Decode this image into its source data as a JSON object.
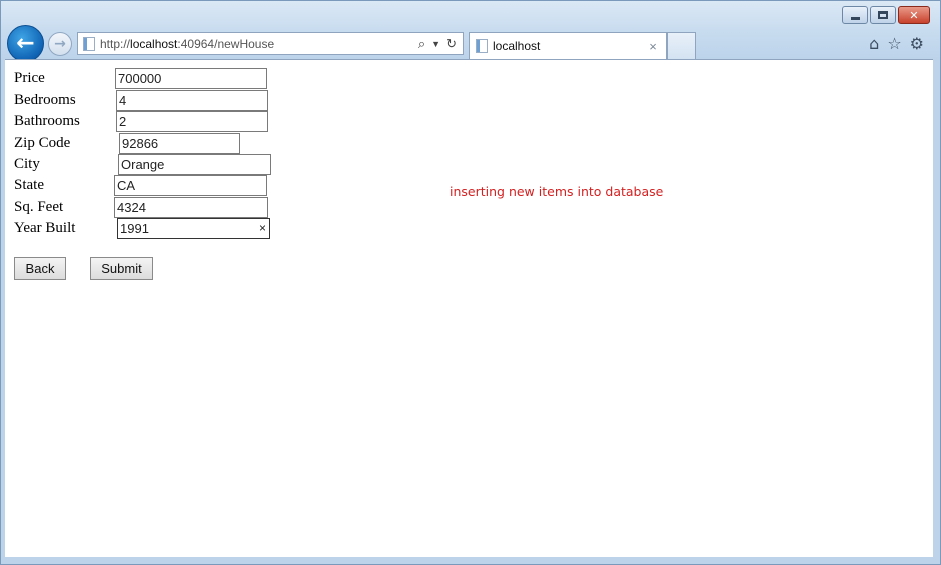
{
  "browser": {
    "url_prefix": "http://",
    "url_host": "localhost",
    "url_rest": ":40964/newHouse",
    "tab_title": "localhost",
    "tab_close": "×"
  },
  "form": {
    "fields": [
      {
        "label": "Price",
        "value": "700000"
      },
      {
        "label": "Bedrooms",
        "value": "4"
      },
      {
        "label": "Bathrooms",
        "value": "2"
      },
      {
        "label": "Zip Code",
        "value": "92866"
      },
      {
        "label": "City",
        "value": "Orange"
      },
      {
        "label": "State",
        "value": "CA"
      },
      {
        "label": "Sq. Feet",
        "value": "4324"
      },
      {
        "label": "Year Built",
        "value": "1991"
      }
    ],
    "clear_glyph": "×",
    "back_label": "Back",
    "submit_label": "Submit"
  },
  "status": {
    "message": "inserting new items into database",
    "color": "#d42020"
  },
  "icons": [
    "back-arrow-icon",
    "forward-arrow-icon",
    "page-icon",
    "search-icon",
    "refresh-icon",
    "home-icon",
    "star-icon",
    "gear-icon"
  ]
}
